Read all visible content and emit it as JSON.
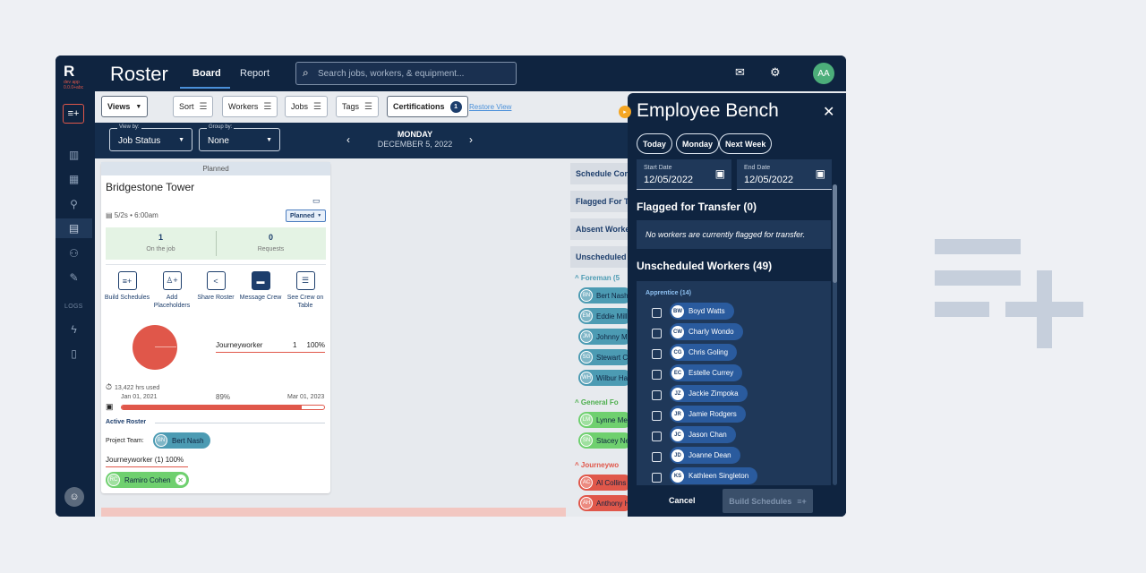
{
  "app": {
    "logo": "R",
    "logo_sub": "dev app 0.0.0+abc",
    "title": "Roster",
    "tabs": [
      "Board",
      "Report"
    ],
    "search_placeholder": "Search jobs, workers, & equipment...",
    "avatar_initials": "AA",
    "rail_section_label": "LOGS"
  },
  "toolbar": {
    "views": "Views",
    "sort": "Sort",
    "workers": "Workers",
    "jobs": "Jobs",
    "tags": "Tags",
    "certifications": "Certifications",
    "certifications_count": "1",
    "restore_view": "Restore View"
  },
  "viewbar": {
    "view_by_label": "View by:",
    "view_by_value": "Job Status",
    "group_by_label": "Group by:",
    "group_by_value": "None",
    "day": "MONDAY",
    "date": "DECEMBER 5, 2022"
  },
  "card": {
    "status": "Planned",
    "title": "Bridgestone Tower",
    "date_info": "5/2s • 6:00am",
    "status_dropdown": "Planned",
    "stats": [
      {
        "value": "1",
        "caption": "On the job"
      },
      {
        "value": "0",
        "caption": "Requests"
      }
    ],
    "actions": [
      {
        "label": "Build Schedules",
        "icon": "build-schedules-icon"
      },
      {
        "label": "Add Placeholders",
        "icon": "add-person-icon"
      },
      {
        "label": "Share Roster",
        "icon": "share-icon"
      },
      {
        "label": "Message Crew",
        "icon": "message-icon"
      },
      {
        "label": "See Crew on Table",
        "icon": "table-icon"
      }
    ],
    "legend": {
      "name": "Journeyworker",
      "count": "1",
      "percent": "100%"
    },
    "hours_used": "13,422 hrs used",
    "start_date": "Jan 01, 2021",
    "progress_pct": "89%",
    "progress_value": 89,
    "end_date": "Mar 01, 2023",
    "active_roster": "Active Roster",
    "project_team_label": "Project Team:",
    "project_team_member": {
      "initials": "BN",
      "name": "Bert Nash"
    },
    "role_summary": "Journeyworker (1) 100%",
    "role_member": {
      "initials": "RC",
      "name": "Ramiro Cohen"
    }
  },
  "column": {
    "headers": [
      "Schedule Con",
      "Flagged For T",
      "Absent Worke",
      "Unscheduled"
    ],
    "groups": [
      {
        "label": "Foreman (5",
        "color": "#4c9bb3",
        "members": [
          {
            "initials": "BN",
            "name": "Bert Nash"
          },
          {
            "initials": "EM",
            "name": "Eddie Mill"
          },
          {
            "initials": "JM",
            "name": "Johnny M"
          },
          {
            "initials": "SG",
            "name": "Stewart C"
          },
          {
            "initials": "WH",
            "name": "Wilbur Ha"
          }
        ]
      },
      {
        "label": "General Fo",
        "color": "#6fd06f",
        "members": [
          {
            "initials": "LM",
            "name": "Lynne Me"
          },
          {
            "initials": "SN",
            "name": "Stacey Ne"
          }
        ]
      },
      {
        "label": "Journeywo",
        "color": "#e0574a",
        "members": [
          {
            "initials": "AC",
            "name": "Al Collins"
          },
          {
            "initials": "AH",
            "name": "Anthony H"
          }
        ]
      }
    ]
  },
  "bench": {
    "title": "Employee Bench",
    "quick_dates": [
      "Today",
      "Monday",
      "Next Week"
    ],
    "start_label": "Start Date",
    "start_value": "12/05/2022",
    "end_label": "End Date",
    "end_value": "12/05/2022",
    "flagged_title": "Flagged for Transfer (0)",
    "flagged_empty": "No workers are currently flagged for transfer.",
    "unscheduled_title": "Unscheduled Workers (49)",
    "apprentice_label": "Apprentice (14)",
    "workers": [
      {
        "initials": "BW",
        "name": "Boyd Watts"
      },
      {
        "initials": "CW",
        "name": "Charly Wondo"
      },
      {
        "initials": "CG",
        "name": "Chris Goling"
      },
      {
        "initials": "EC",
        "name": "Estelle Currey"
      },
      {
        "initials": "JZ",
        "name": "Jackie Zimpoka"
      },
      {
        "initials": "JR",
        "name": "Jamie Rodgers"
      },
      {
        "initials": "JC",
        "name": "Jason Chan"
      },
      {
        "initials": "JD",
        "name": "Joanne Dean"
      },
      {
        "initials": "KS",
        "name": "Kathleen Singleton"
      }
    ],
    "cancel": "Cancel",
    "build": "Build Schedules"
  },
  "colors": {
    "navy": "#0f2440",
    "accent_red": "#e0574a",
    "accent_green": "#6fd06f",
    "accent_teal": "#4c9bb3",
    "chip_blue": "#2a5b9e"
  }
}
